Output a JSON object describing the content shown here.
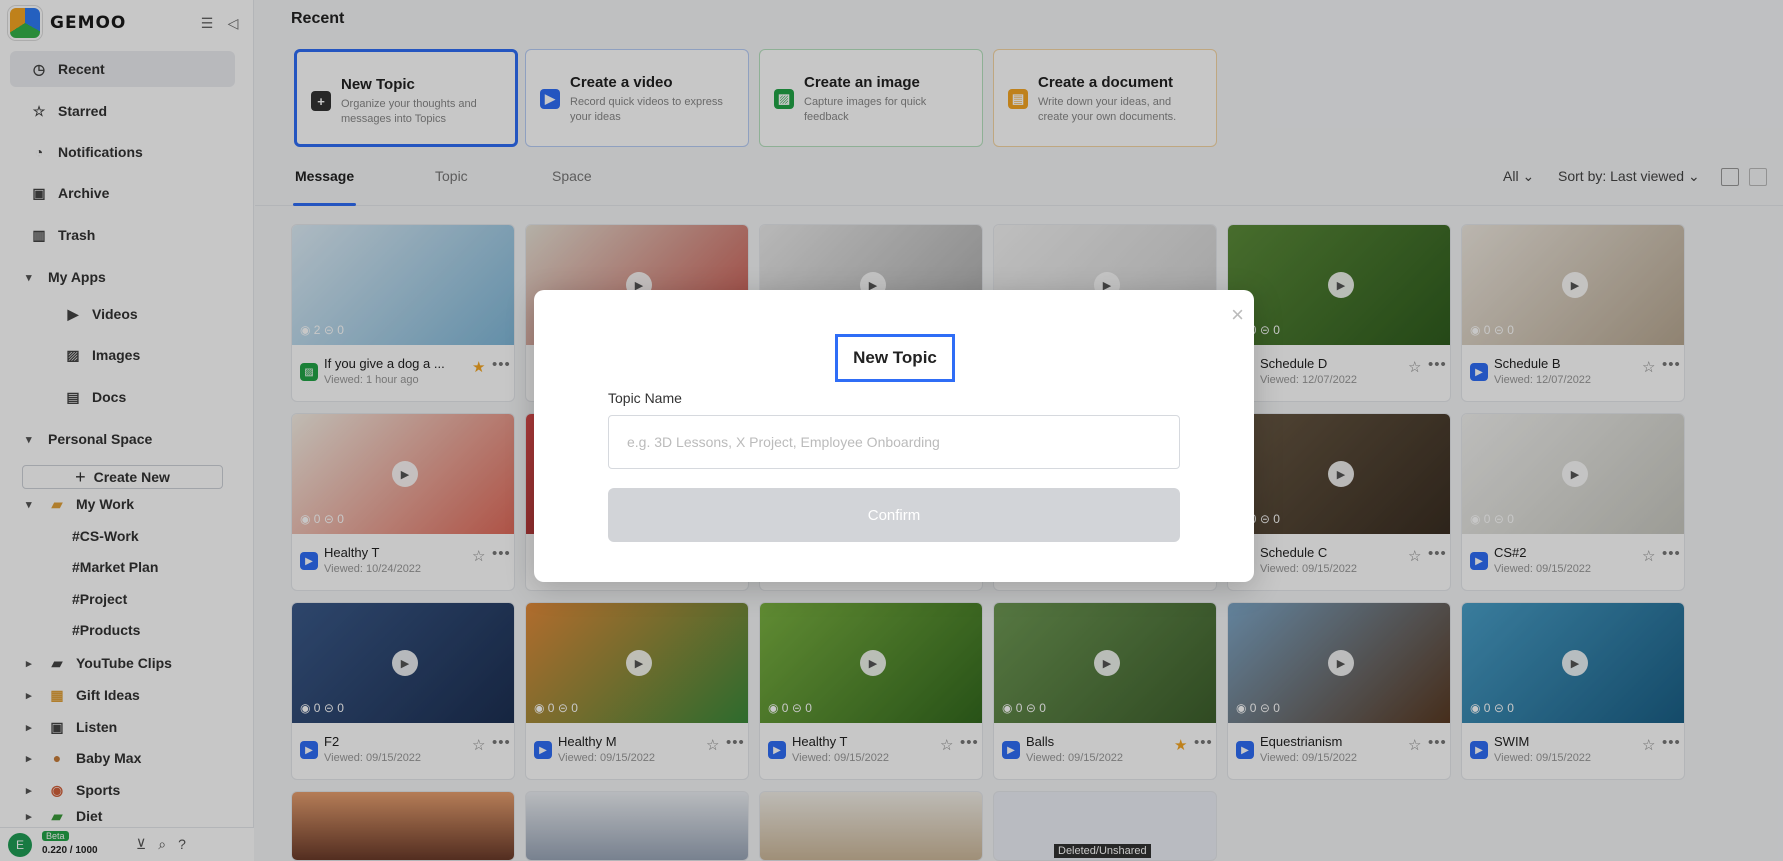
{
  "app": {
    "name": "GEMOO"
  },
  "sidebar": {
    "items": [
      {
        "label": "Recent"
      },
      {
        "label": "Starred"
      },
      {
        "label": "Notifications"
      },
      {
        "label": "Archive"
      },
      {
        "label": "Trash"
      }
    ],
    "my_apps": {
      "label": "My Apps",
      "items": [
        {
          "label": "Videos"
        },
        {
          "label": "Images"
        },
        {
          "label": "Docs"
        }
      ]
    },
    "personal_space": {
      "label": "Personal Space",
      "create_new": "Create New"
    },
    "folders": [
      {
        "label": "My Work",
        "children": [
          {
            "label": "#CS-Work"
          },
          {
            "label": "#Market Plan"
          },
          {
            "label": "#Project"
          },
          {
            "label": "#Products"
          }
        ]
      },
      {
        "label": "YouTube Clips"
      },
      {
        "label": "Gift Ideas"
      },
      {
        "label": "Listen"
      },
      {
        "label": "Baby Max"
      },
      {
        "label": "Sports"
      },
      {
        "label": "Diet"
      }
    ],
    "bottom": {
      "avatar": "E",
      "badge": "Beta",
      "storage": "0.220 / 1000"
    }
  },
  "main": {
    "title": "Recent",
    "create_cards": [
      {
        "title": "New Topic",
        "desc": "Organize your thoughts and messages into Topics",
        "icon": "plus-icon",
        "color": "#333333"
      },
      {
        "title": "Create a video",
        "desc": "Record quick videos to express your ideas",
        "icon": "video-icon",
        "color": "#2f6df6"
      },
      {
        "title": "Create an image",
        "desc": "Capture images for quick feedback",
        "icon": "image-icon",
        "color": "#22a447"
      },
      {
        "title": "Create a document",
        "desc": "Write down your ideas, and create your own documents.",
        "icon": "doc-icon",
        "color": "#f5a623"
      }
    ],
    "tabs": [
      {
        "label": "Message"
      },
      {
        "label": "Topic"
      },
      {
        "label": "Space"
      }
    ],
    "filter": "All",
    "sort": "Sort by: Last viewed",
    "cards": [
      {
        "title": "If you give a dog a ...",
        "sub": "Viewed: 1 hour ago",
        "views": "2",
        "comments": "0",
        "starred": true,
        "type": "image"
      },
      {
        "title": "",
        "sub": "",
        "views": "",
        "comments": "",
        "starred": false,
        "type": "video"
      },
      {
        "title": "",
        "sub": "",
        "views": "",
        "comments": "",
        "starred": false,
        "type": "video"
      },
      {
        "title": "",
        "sub": "",
        "views": "",
        "comments": "",
        "starred": false,
        "type": "video"
      },
      {
        "title": "Schedule D",
        "sub": "Viewed: 12/07/2022",
        "views": "0",
        "comments": "0",
        "starred": false,
        "type": "video"
      },
      {
        "title": "Schedule B",
        "sub": "Viewed: 12/07/2022",
        "views": "0",
        "comments": "0",
        "starred": false,
        "type": "video"
      },
      {
        "title": "Healthy T",
        "sub": "Viewed: 10/24/2022",
        "views": "0",
        "comments": "0",
        "starred": false,
        "type": "video"
      },
      {
        "title": "",
        "sub": "",
        "views": "",
        "comments": "",
        "starred": false,
        "type": "video"
      },
      {
        "title": "",
        "sub": "",
        "views": "",
        "comments": "",
        "starred": false,
        "type": "video"
      },
      {
        "title": "",
        "sub": "",
        "views": "",
        "comments": "",
        "starred": false,
        "type": "video"
      },
      {
        "title": "Schedule C",
        "sub": "Viewed: 09/15/2022",
        "views": "0",
        "comments": "0",
        "starred": false,
        "type": "video"
      },
      {
        "title": "CS#2",
        "sub": "Viewed: 09/15/2022",
        "views": "0",
        "comments": "0",
        "starred": false,
        "type": "video"
      },
      {
        "title": "F2",
        "sub": "Viewed: 09/15/2022",
        "views": "0",
        "comments": "0",
        "starred": false,
        "type": "video"
      },
      {
        "title": "Healthy M",
        "sub": "Viewed: 09/15/2022",
        "views": "0",
        "comments": "0",
        "starred": false,
        "type": "video"
      },
      {
        "title": "Healthy T",
        "sub": "Viewed: 09/15/2022",
        "views": "0",
        "comments": "0",
        "starred": false,
        "type": "video"
      },
      {
        "title": "Balls",
        "sub": "Viewed: 09/15/2022",
        "views": "0",
        "comments": "0",
        "starred": true,
        "type": "video"
      },
      {
        "title": "Equestrianism",
        "sub": "Viewed: 09/15/2022",
        "views": "0",
        "comments": "0",
        "starred": false,
        "type": "video"
      },
      {
        "title": "SWIM",
        "sub": "Viewed: 09/15/2022",
        "views": "0",
        "comments": "0",
        "starred": false,
        "type": "video"
      }
    ],
    "partial_row_note": "Deleted/Unshared"
  },
  "modal": {
    "title": "New Topic",
    "label": "Topic Name",
    "placeholder": "e.g. 3D Lessons, X Project, Employee Onboarding",
    "confirm": "Confirm"
  }
}
